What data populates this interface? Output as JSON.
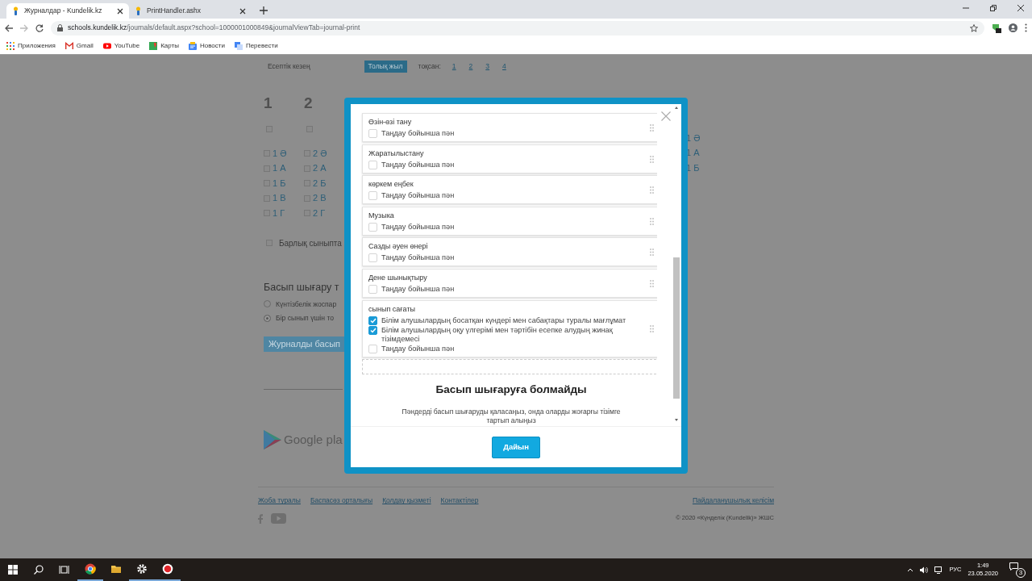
{
  "browser": {
    "tabs": [
      {
        "title": "Журналдар - Kundelik.kz",
        "selected": true
      },
      {
        "title": "PrintHandler.ashx",
        "selected": false
      }
    ],
    "address": {
      "host": "schools.kundelik.kz",
      "path": "/journals/default.aspx?school=1000001000849&journalViewTab=journal-print"
    },
    "bookmarks": [
      {
        "label": "Приложения",
        "kind": "apps"
      },
      {
        "label": "Gmail",
        "kind": "gmail"
      },
      {
        "label": "YouTube",
        "kind": "youtube"
      },
      {
        "label": "Карты",
        "kind": "maps"
      },
      {
        "label": "Новости",
        "kind": "news"
      },
      {
        "label": "Перевести",
        "kind": "translate"
      }
    ]
  },
  "page": {
    "period_label": "Есептік кезең",
    "period_tabs": [
      {
        "label": "Толық жыл",
        "selected": true
      }
    ],
    "quarter_label": "тоқсан:",
    "quarters": [
      {
        "label": "1",
        "selected": false
      },
      {
        "label": "2",
        "selected": false
      },
      {
        "label": "3",
        "selected": false
      },
      {
        "label": "4",
        "selected": false
      }
    ],
    "grade_columns": [
      {
        "heading": "1",
        "checked": false,
        "classes": [
          {
            "label": "1 Ә",
            "checked": false
          },
          {
            "label": "1 А",
            "checked": false
          },
          {
            "label": "1 Б",
            "checked": false
          },
          {
            "label": "1 В",
            "checked": false
          },
          {
            "label": "1 Г",
            "checked": false
          }
        ]
      },
      {
        "heading": "2",
        "checked": false,
        "classes": [
          {
            "label": "2 Ә",
            "checked": false
          },
          {
            "label": "2 А",
            "checked": false
          },
          {
            "label": "2 Б",
            "checked": false
          },
          {
            "label": "2 В",
            "checked": false
          },
          {
            "label": "2 Г",
            "checked": false
          }
        ]
      }
    ],
    "right_column_classes": [
      "1 Ә",
      "1 А",
      "1 Б"
    ],
    "all_classes": {
      "label": "Барлық сыныпта",
      "checked": false
    },
    "print_type": {
      "title": "Басып шығару т",
      "options": [
        {
          "label": "Күнтізбелік жоспар",
          "selected": false
        },
        {
          "label": "Бір сынып үшін то",
          "selected": true
        }
      ]
    },
    "print_button": "Журналды басып",
    "store_badge": "Google pla",
    "footer": {
      "links": [
        "Жоба туралы",
        "Баспасөз орталығы",
        "Қолдау қызметі",
        "Контактілер"
      ],
      "agreement": "Пайдаланушылық келісім",
      "copyright": "© 2020 «Күнделік (Kundelik)» ЖШС"
    }
  },
  "dialog": {
    "subjects": [
      {
        "name": "Өзін-өзі тану",
        "options": [
          {
            "label": "Таңдау бойынша пән",
            "checked": false
          }
        ]
      },
      {
        "name": "Жаратылыстану",
        "options": [
          {
            "label": "Таңдау бойынша пән",
            "checked": false
          }
        ]
      },
      {
        "name": "көркем еңбек",
        "options": [
          {
            "label": "Таңдау бойынша пән",
            "checked": false
          }
        ]
      },
      {
        "name": "Музыка",
        "options": [
          {
            "label": "Таңдау бойынша пән",
            "checked": false
          }
        ]
      },
      {
        "name": "Сазды әуен өнері",
        "options": [
          {
            "label": "Таңдау бойынша пән",
            "checked": false
          }
        ]
      },
      {
        "name": "Дене шынықтыру",
        "options": [
          {
            "label": "Таңдау бойынша пән",
            "checked": false
          }
        ]
      },
      {
        "name": "сынып сағаты",
        "options": [
          {
            "label": "Білім алушылардың босатқан күндері мен сабақтары туралы мағлұмат",
            "checked": true
          },
          {
            "label": "Білім алушылардың оқу үлгерімі мен тәртібін есепке алудың жинақ тізімдемесі",
            "checked": true
          },
          {
            "label": "Таңдау бойынша пән",
            "checked": false
          }
        ]
      }
    ],
    "empty_title": "Басып шығаруға болмайды",
    "hint": "Пәндерді басып шығаруды қаласаңыз, онда оларды жоғарғы тізімге тартып алыңыз",
    "done_button": "Дайын"
  },
  "taskbar": {
    "apps": [
      {
        "kind": "chrome",
        "running": true
      },
      {
        "kind": "explorer",
        "running": false
      },
      {
        "kind": "settings",
        "running": true
      },
      {
        "kind": "recorder",
        "running": true
      }
    ],
    "language": "РУС",
    "time": "1:49",
    "date": "23.05.2020",
    "notifications": "3"
  }
}
